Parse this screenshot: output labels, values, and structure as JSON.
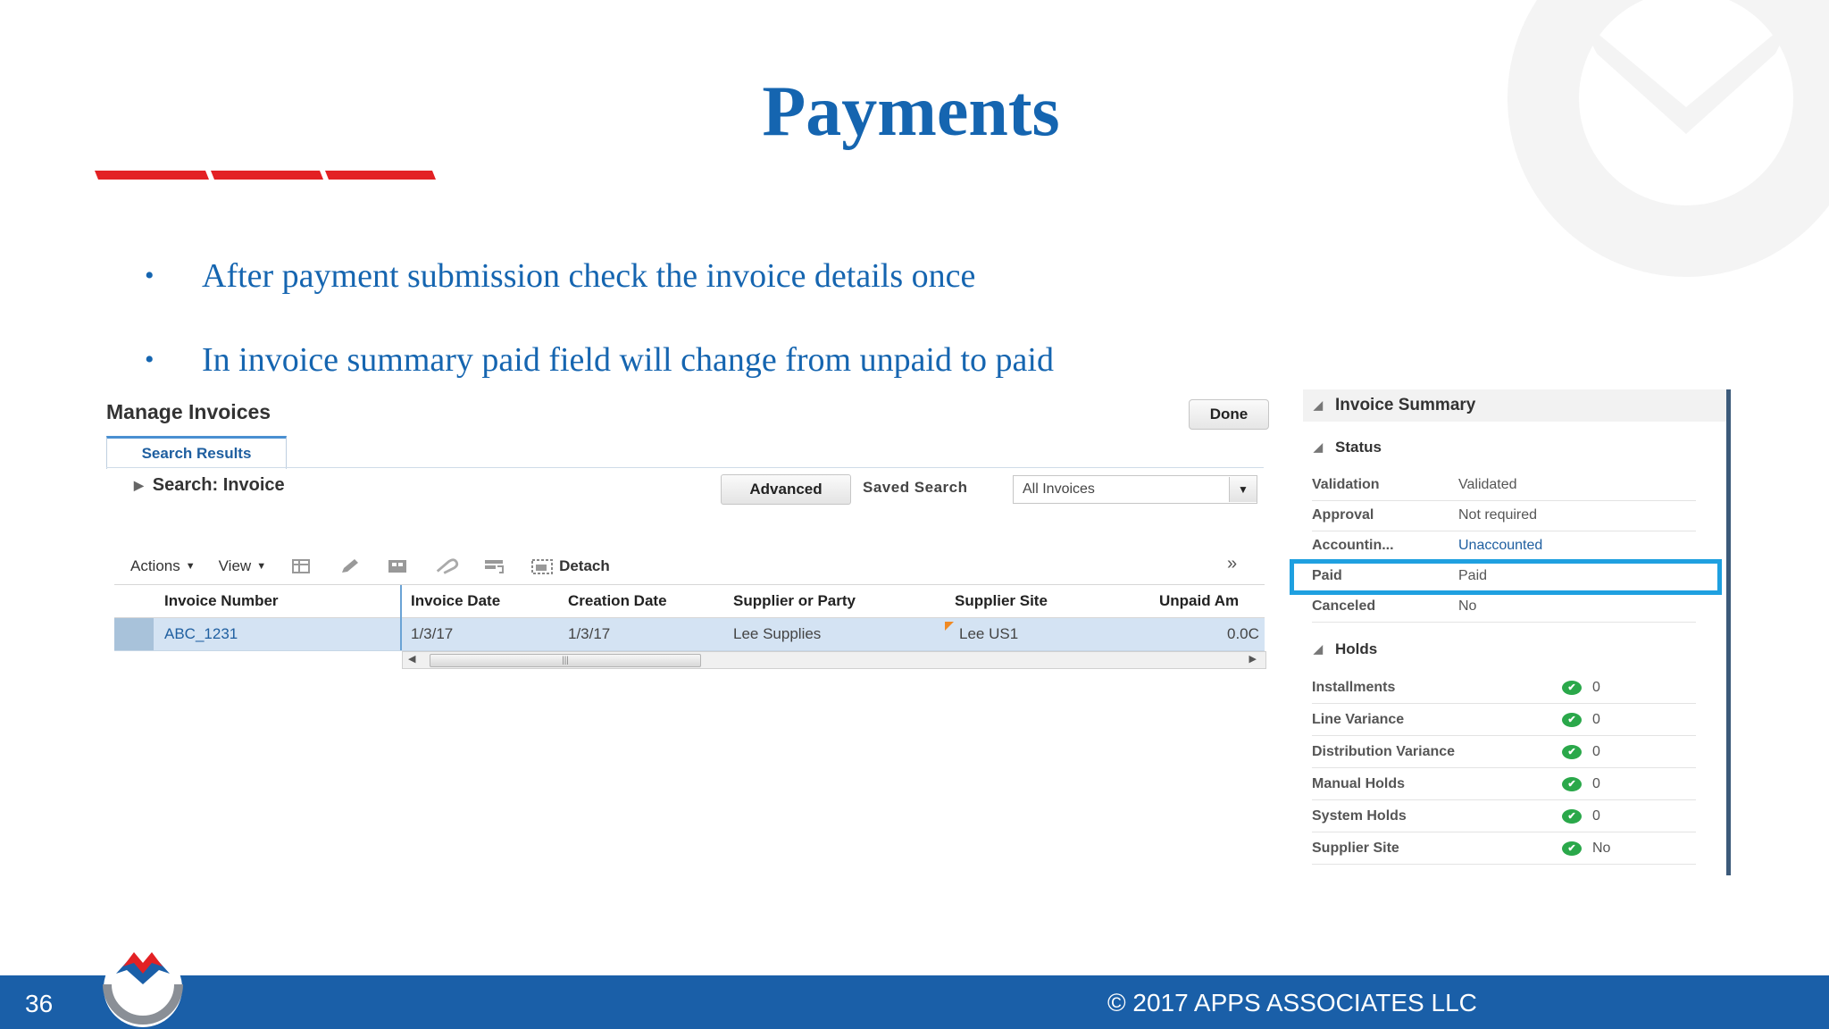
{
  "slide": {
    "title": "Payments",
    "bullets": [
      "After payment submission check the invoice details once",
      "In invoice summary paid field will change from unpaid to paid"
    ],
    "page_number": "36",
    "copyright": "© 2017 APPS ASSOCIATES LLC",
    "colors": {
      "title": "#1565b0",
      "accent_red": "#e32124",
      "footer": "#1a5fa8",
      "highlight": "#1fa0e0"
    }
  },
  "manage": {
    "title": "Manage Invoices",
    "done_label": "Done",
    "tab_label": "Search Results",
    "search_label": "Search: Invoice",
    "advanced_label": "Advanced",
    "saved_search_label": "Saved Search",
    "saved_search_value": "All Invoices",
    "toolbar": {
      "actions_label": "Actions",
      "view_label": "View",
      "detach_label": "Detach",
      "icons": [
        "export-icon",
        "edit-icon",
        "freeze-icon",
        "attach-icon",
        "wrap-icon",
        "detach-icon"
      ]
    },
    "table": {
      "columns": [
        "Invoice Number",
        "Invoice Date",
        "Creation Date",
        "Supplier or Party",
        "Supplier Site",
        "Unpaid Am"
      ],
      "rows": [
        [
          "ABC_1231",
          "1/3/17",
          "1/3/17",
          "Lee Supplies",
          "Lee US1",
          "0.0C"
        ]
      ]
    }
  },
  "summary": {
    "title": "Invoice Summary",
    "status_heading": "Status",
    "status_rows": [
      {
        "label": "Validation",
        "value": "Validated"
      },
      {
        "label": "Approval",
        "value": "Not required"
      },
      {
        "label": "Accountin...",
        "value": "Unaccounted"
      },
      {
        "label": "Paid",
        "value": "Paid"
      },
      {
        "label": "Canceled",
        "value": "No"
      }
    ],
    "holds_heading": "Holds",
    "holds_rows": [
      {
        "label": "Installments",
        "value": "0"
      },
      {
        "label": "Line Variance",
        "value": "0"
      },
      {
        "label": "Distribution Variance",
        "value": "0"
      },
      {
        "label": "Manual Holds",
        "value": "0"
      },
      {
        "label": "System Holds",
        "value": "0"
      },
      {
        "label": "Supplier Site",
        "value": "No"
      }
    ]
  }
}
